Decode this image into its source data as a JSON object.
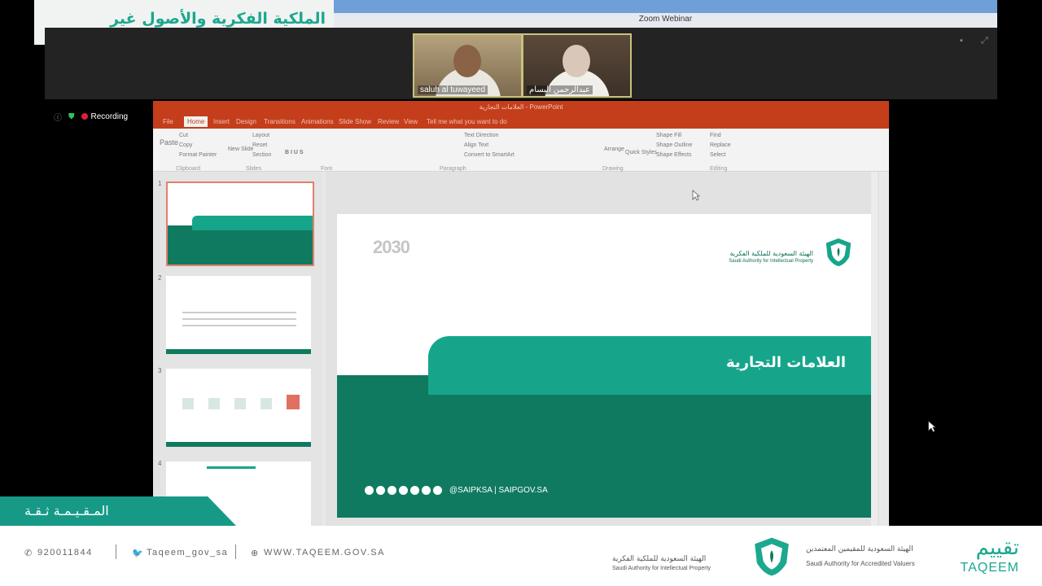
{
  "banner": {
    "title": "الملكية الفكرية والأصول غير الملموسة"
  },
  "zoom": {
    "window_title": "Zoom Webinar",
    "participants": [
      {
        "name": "saluh al tuwayeed"
      },
      {
        "name": "عبدالرحمن البسام"
      }
    ],
    "recording_label": "Recording"
  },
  "ppt": {
    "title": "العلامات التجارية - PowerPoint",
    "tabs": [
      "File",
      "Home",
      "Insert",
      "Design",
      "Transitions",
      "Animations",
      "Slide Show",
      "Review",
      "View",
      "Tell me what you want to do"
    ],
    "active_tab": "Home",
    "ribbon_groups": [
      "Clipboard",
      "Slides",
      "Font",
      "Paragraph",
      "Drawing",
      "Editing"
    ],
    "ribbon_items": {
      "paste": "Paste",
      "cut": "Cut",
      "copy": "Copy",
      "format_painter": "Format Painter",
      "new_slide": "New Slide",
      "layout": "Layout",
      "reset": "Reset",
      "section": "Section",
      "find": "Find",
      "replace": "Replace",
      "select": "Select",
      "arrange": "Arrange",
      "text_direction": "Text Direction",
      "align_text": "Align Text",
      "convert_smartart": "Convert to SmartArt",
      "shape_fill": "Shape Fill",
      "shape_outline": "Shape Outline",
      "shape_effects": "Shape Effects",
      "quick_styles": "Quick Styles"
    },
    "thumb_numbers": [
      "1",
      "2",
      "3",
      "4"
    ],
    "slide": {
      "title": "العلامات التجارية",
      "vision": "2030",
      "org_ar": "الهيئة السعودية للملكية الفكرية",
      "org_en": "Saudi Authority for Intellectual Property",
      "social": "@SAIPKSA | SAIPGOV.SA"
    }
  },
  "bottom": {
    "greenbar_text": "المـقـيـمـة ثـقـة",
    "phone": "920011844",
    "twitter": "Taqeem_gov_sa",
    "website": "WWW.TAQEEM.GOV.SA",
    "taqeem_ar": "تقييم",
    "taqeem_en": "TAQEEM",
    "sat_ar": "الهيئة السعودية للمقيمين المعتمدين",
    "sat_en": "Saudi Authority for Accredited Valuers",
    "saip_ar": "الهيئة السعودية للملكية الفكرية",
    "saip_en": "Saudi Authority for Intellectual Property"
  },
  "colors": {
    "ppt_red": "#c43e1c",
    "slide_teal": "#16a58b",
    "slide_dark": "#0f7a5f",
    "brand_green": "#1aa88e",
    "record_red": "#e01e3a"
  }
}
